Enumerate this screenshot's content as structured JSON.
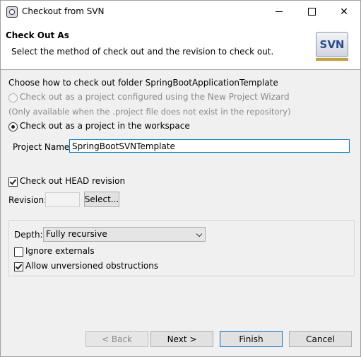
{
  "window": {
    "title": "Checkout from SVN",
    "controls": {
      "minimize": "minimize-icon",
      "maximize": "maximize-icon",
      "close": "✕"
    }
  },
  "banner": {
    "title": "Check Out As",
    "description": "Select the method of check out and the revision to check out.",
    "logo_text": "SVN"
  },
  "checkout": {
    "heading": "Choose how to check out folder SpringBootApplicationTemplate",
    "option_wizard": "Check out as a project configured using the New Project Wizard",
    "option_wizard_note": "(Only available when the .project file does not exist in the repository)",
    "option_workspace": "Check out as a project in the workspace",
    "selected_option": "workspace",
    "project_name_label": "Project Name:",
    "project_name_value": "SpringBootSVNTemplate"
  },
  "revision": {
    "head_checkbox_label": "Check out HEAD revision",
    "head_checked": true,
    "revision_label": "Revision:",
    "revision_value": "",
    "select_button": "Select..."
  },
  "options": {
    "depth_label": "Depth:",
    "depth_value": "Fully recursive",
    "ignore_externals_label": "Ignore externals",
    "ignore_externals_checked": false,
    "allow_unversioned_label": "Allow unversioned obstructions",
    "allow_unversioned_checked": true
  },
  "footer": {
    "back": "< Back",
    "next": "Next >",
    "finish": "Finish",
    "cancel": "Cancel"
  }
}
